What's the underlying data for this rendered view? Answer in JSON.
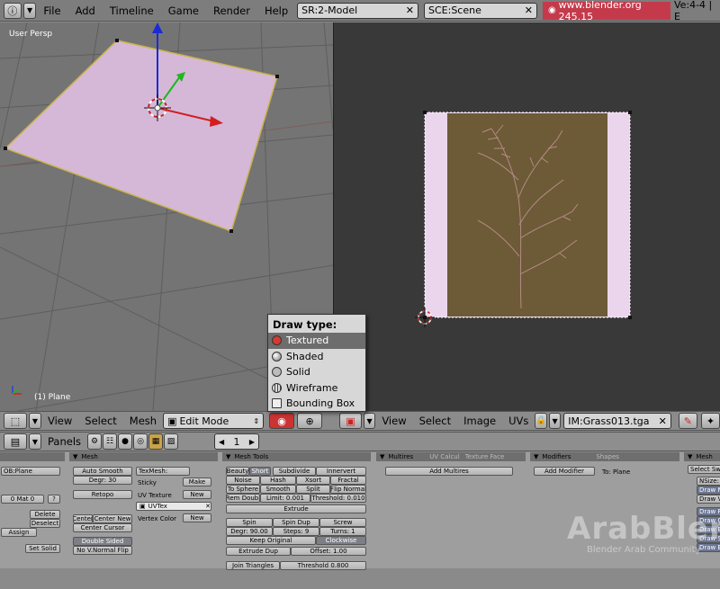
{
  "topbar": {
    "menus": [
      "File",
      "Add",
      "Timeline",
      "Game",
      "Render",
      "Help"
    ],
    "screen_field": "SR:2-Model",
    "scene_field": "SCE:Scene",
    "url": "www.blender.org 245.15",
    "stats": "Ve:4-4 | E"
  },
  "view3d": {
    "label": "User Persp",
    "object_label": "(1) Plane"
  },
  "popup": {
    "title": "Draw type:",
    "items": [
      "Textured",
      "Shaded",
      "Solid",
      "Wireframe",
      "Bounding Box"
    ]
  },
  "header3d": {
    "view": "View",
    "select": "Select",
    "mesh": "Mesh",
    "mode": "Edit Mode"
  },
  "headerimg": {
    "view": "View",
    "select": "Select",
    "image": "Image",
    "uvs": "UVs",
    "image_name": "IM:Grass013.tga"
  },
  "panelsbar": {
    "label": "Panels",
    "frame": "1"
  },
  "link": {
    "ob": "OB:Plane",
    "mat": "0 Mat 0",
    "q": "?",
    "delete": "Delete",
    "deselect": "Deselect",
    "assign": "Assign",
    "set_solid": "Set Solid"
  },
  "mesh": {
    "header": "Mesh",
    "auto_smooth": "Auto Smooth",
    "degr": "Degr: 30",
    "retopo": "Retopo",
    "center": "Center",
    "center_new": "Center New",
    "center_cursor": "Center Cursor",
    "double_sided": "Double Sided",
    "no_vnormal_flip": "No V.Normal Flip",
    "texmesh": "TexMesh:",
    "sticky": "Sticky",
    "make": "Make",
    "uv_texture": "UV Texture",
    "new": "New",
    "uvtex": "UVTex",
    "vertex_color": "Vertex Color",
    "new2": "New"
  },
  "meshtools": {
    "header": "Mesh Tools",
    "beauty": "Beauty",
    "short": "Short",
    "subdivide": "Subdivide",
    "innervert": "Innervert",
    "noise": "Noise",
    "hash": "Hash",
    "xsort": "Xsort",
    "fractal": "Fractal",
    "to_sphere": "To Sphere",
    "smooth": "Smooth",
    "split": "Split",
    "flip_normal": "Flip Normal",
    "rem_doubl": "Rem Doubl",
    "limit": "Limit: 0.001",
    "threshold": "Threshold: 0.010",
    "extrude": "Extrude",
    "spin": "Spin",
    "spin_dup": "Spin Dup",
    "screw": "Screw",
    "degr90": "Degr: 90.00",
    "steps": "Steps: 9",
    "turns": "Turns: 1",
    "keep_original": "Keep Original",
    "clockwise": "Clockwise",
    "extrude_dup": "Extrude Dup",
    "offset": "Offset: 1.00",
    "join_triangles": "Join Triangles",
    "threshold2": "Threshold 0.800"
  },
  "multires": {
    "tab1": "Multires",
    "tab2": "UV Calcul",
    "tab3": "Texture Face",
    "add_multires": "Add Multires"
  },
  "modifiers": {
    "tab1": "Modifiers",
    "tab2": "Shapes",
    "add_modifier": "Add Modifier",
    "to": "To: Plane"
  },
  "rightpanel": {
    "header": "Mesh",
    "select_sw": "Select Sw",
    "nsize": "NSize:",
    "draw_n": "Draw N",
    "draw_vn": "Draw VN",
    "draw_f": "Draw F",
    "draw_c": "Draw C",
    "draw_bevel": "Draw Beve",
    "draw_s": "Draw S",
    "draw_e": "Draw E"
  },
  "watermark": {
    "brand": "ArabBlen",
    "tagline": "Blender Arab Community"
  },
  "colors": {
    "plane_fill": "#d5b8d8",
    "plane_edge": "#c9b44a",
    "image_bg": "#6d5a37",
    "image_side": "#ebd5ec",
    "popup_highlight": "#6d6d6d",
    "url_bg": "#c43a4b"
  }
}
